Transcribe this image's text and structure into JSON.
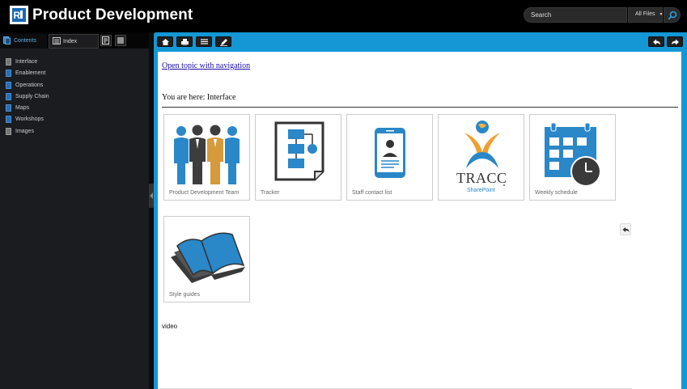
{
  "header": {
    "title": "Product Development",
    "search_placeholder": "Search",
    "scope_value": "All Files",
    "scope_arrow": "▼"
  },
  "sidebar": {
    "tabs": [
      {
        "label": "Contents",
        "active": true
      },
      {
        "label": "Index",
        "active": false
      }
    ],
    "toc": [
      {
        "label": "Interface",
        "icon": "gray-doc-icon"
      },
      {
        "label": "Enablement",
        "icon": "book-icon"
      },
      {
        "label": "Operations",
        "icon": "book-icon"
      },
      {
        "label": "Supply Chain",
        "icon": "book-icon"
      },
      {
        "label": "Maps",
        "icon": "book-icon"
      },
      {
        "label": "Workshops",
        "icon": "book-icon"
      },
      {
        "label": "Images",
        "icon": "gray-doc-icon"
      }
    ]
  },
  "content": {
    "nav_link": "Open topic with navigation",
    "breadcrumb": "You are here: Interface",
    "tiles": [
      {
        "label": "Product Development Team",
        "icon": "team-icon"
      },
      {
        "label": "Tracker",
        "icon": "flowchart-icon"
      },
      {
        "label": "Staff contact list",
        "icon": "phone-contact-icon"
      },
      {
        "label": "",
        "icon": "tracc-sharepoint-logo",
        "logo_text": "TRACC",
        "logo_sub": "SharePoint"
      },
      {
        "label": "Weekly schedule",
        "icon": "calendar-clock-icon"
      },
      {
        "label": "Style guides",
        "icon": "open-book-icon"
      }
    ],
    "video_label": "video"
  },
  "colors": {
    "accent": "#1497d4",
    "brand_blue": "#1a6ab3",
    "icon_blue": "#2a87c8",
    "link": "#1a0dab"
  }
}
